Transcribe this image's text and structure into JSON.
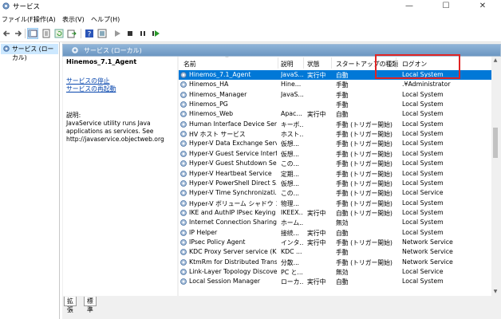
{
  "window": {
    "title": "サービス",
    "minimize": "—",
    "maximize": "☐",
    "close": "✕"
  },
  "menu": [
    "ファイル(F)",
    "操作(A)",
    "表示(V)",
    "ヘルプ(H)"
  ],
  "tree": {
    "root": "サービス (ローカル)"
  },
  "pane": {
    "header": "サービス (ローカル)"
  },
  "detail": {
    "service_name": "Hinemos_7.1_Agent",
    "stop_link": "サービスの停止",
    "restart_link": "サービスの再起動",
    "desc_label": "説明:",
    "desc_text": "JavaService utility runs Java applications as services. See http://javaservice.objectweb.org"
  },
  "columns": {
    "name": "名前",
    "desc": "説明",
    "status": "状態",
    "startup": "スタートアップの種類",
    "logon": "ログオン"
  },
  "services": [
    {
      "name": "Hinemos_7.1_Agent",
      "desc": "JavaS...",
      "status": "実行中",
      "startup": "自動",
      "logon": "Local System",
      "selected": true
    },
    {
      "name": "Hinemos_HA",
      "desc": "Hine...",
      "status": "",
      "startup": "手動",
      "logon": ".¥Administrator"
    },
    {
      "name": "Hinemos_Manager",
      "desc": "JavaS...",
      "status": "",
      "startup": "手動",
      "logon": "Local System"
    },
    {
      "name": "Hinemos_PG",
      "desc": "",
      "status": "",
      "startup": "手動",
      "logon": "Local System"
    },
    {
      "name": "Hinemos_Web",
      "desc": "Apac...",
      "status": "実行中",
      "startup": "自動",
      "logon": "Local System"
    },
    {
      "name": "Human Interface Device Serv...",
      "desc": "キーボ...",
      "status": "",
      "startup": "手動 (トリガー開始)",
      "logon": "Local System"
    },
    {
      "name": "HV ホスト サービス",
      "desc": "ホスト...",
      "status": "",
      "startup": "手動 (トリガー開始)",
      "logon": "Local System"
    },
    {
      "name": "Hyper-V Data Exchange Serv...",
      "desc": "仮想...",
      "status": "",
      "startup": "手動 (トリガー開始)",
      "logon": "Local System"
    },
    {
      "name": "Hyper-V Guest Service Interf...",
      "desc": "仮想...",
      "status": "",
      "startup": "手動 (トリガー開始)",
      "logon": "Local System"
    },
    {
      "name": "Hyper-V Guest Shutdown Se...",
      "desc": "この...",
      "status": "",
      "startup": "手動 (トリガー開始)",
      "logon": "Local System"
    },
    {
      "name": "Hyper-V Heartbeat Service",
      "desc": "定期...",
      "status": "",
      "startup": "手動 (トリガー開始)",
      "logon": "Local System"
    },
    {
      "name": "Hyper-V PowerShell Direct S...",
      "desc": "仮想...",
      "status": "",
      "startup": "手動 (トリガー開始)",
      "logon": "Local System"
    },
    {
      "name": "Hyper-V Time Synchronizati...",
      "desc": "この...",
      "status": "",
      "startup": "手動 (トリガー開始)",
      "logon": "Local Service"
    },
    {
      "name": "Hyper-V ボリューム シャドウ コピ...",
      "desc": "物理...",
      "status": "",
      "startup": "手動 (トリガー開始)",
      "logon": "Local System"
    },
    {
      "name": "IKE and AuthIP IPsec Keying ...",
      "desc": "IKEEX...",
      "status": "実行中",
      "startup": "自動 (トリガー開始)",
      "logon": "Local System"
    },
    {
      "name": "Internet Connection Sharing...",
      "desc": "ホーム...",
      "status": "",
      "startup": "無効",
      "logon": "Local System"
    },
    {
      "name": "IP Helper",
      "desc": "接続...",
      "status": "実行中",
      "startup": "自動",
      "logon": "Local System"
    },
    {
      "name": "IPsec Policy Agent",
      "desc": "インタ...",
      "status": "実行中",
      "startup": "手動 (トリガー開始)",
      "logon": "Network Service"
    },
    {
      "name": "KDC Proxy Server service (KPS)",
      "desc": "KDC ...",
      "status": "",
      "startup": "手動",
      "logon": "Network Service"
    },
    {
      "name": "KtmRm for Distributed Trans...",
      "desc": "分散...",
      "status": "",
      "startup": "手動 (トリガー開始)",
      "logon": "Network Service"
    },
    {
      "name": "Link-Layer Topology Discove...",
      "desc": "PC と...",
      "status": "",
      "startup": "無効",
      "logon": "Local Service"
    },
    {
      "name": "Local Session Manager",
      "desc": "ローカ...",
      "status": "実行中",
      "startup": "自動",
      "logon": "Local System"
    }
  ],
  "tabs": [
    "拡張",
    "標準"
  ],
  "colors": {
    "selection": "#0078d7",
    "highlight_box": "#e02424",
    "header_blue": "#6c97c2"
  }
}
